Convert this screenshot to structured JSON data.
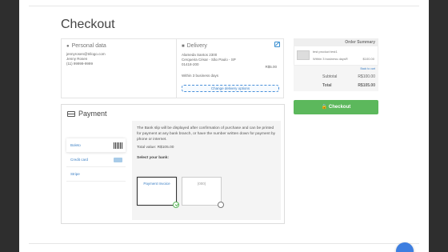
{
  "page": {
    "title": "Checkout"
  },
  "personal": {
    "heading": "Personal data",
    "lines": [
      "jennyrosen@trilogo.com",
      "Jenny Rosen",
      "(11) 99999-9999"
    ]
  },
  "delivery": {
    "heading": "Delivery",
    "address_lines": [
      "Alameda Santos 2300",
      "Cerqueira César - São Paulo - SP",
      "01418-200"
    ],
    "price": "R$5.00",
    "within": "Within 3 business days",
    "change_label": "Change delivery options"
  },
  "summary": {
    "heading": "Order Summary",
    "item_name": "test product test1",
    "item_ship": "Within 3 business daysR",
    "item_price": "$100.00",
    "back_link": "Back to cart",
    "subtotal_label": "Subtotal",
    "subtotal_value": "R$100.00",
    "total_label": "Total",
    "total_value": "R$105.00"
  },
  "checkout_button": {
    "label": "Checkout"
  },
  "payment": {
    "heading": "Payment",
    "methods": [
      "Boleto",
      "Credit card",
      "Stripe"
    ],
    "description": "The Bank slip will be displayed after confirmation of purchase and can be printed for payment at any bank branch, or have the number written down for payment by phone or internet.",
    "total": "Total value: R$105.00",
    "select_bank": "Select your bank:",
    "options": [
      "Payment Invoice",
      "(000)"
    ]
  },
  "colors": {
    "accent": "#3b7fc4",
    "success": "#5cb85c",
    "fab": "#3d7ee0"
  }
}
